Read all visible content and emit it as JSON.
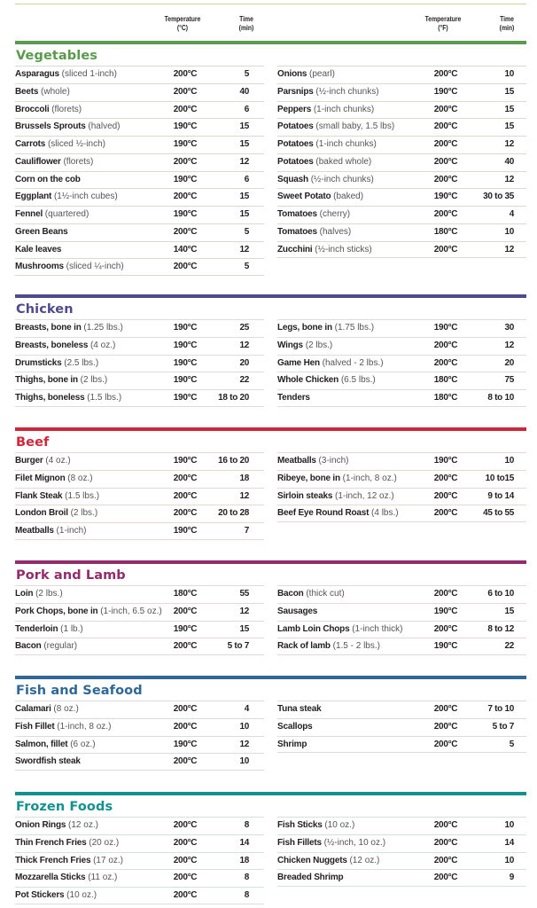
{
  "header": {
    "left_temp_label": "Temperature",
    "left_temp_unit": "(°C)",
    "left_time_label": "Time",
    "left_time_unit": "(min)",
    "right_temp_label": "Temperature",
    "right_temp_unit": "(°F)",
    "right_time_label": "Time",
    "right_time_unit": "(min)"
  },
  "colors": {
    "top_line": "#c9d59a",
    "vegetables": "#5a9a4c",
    "chicken": "#4f4a8c",
    "beef": "#d0263a",
    "pork": "#922c6c",
    "fish": "#2f6896",
    "frozen": "#14918e"
  },
  "sections": [
    {
      "title": "Vegetables",
      "left": [
        {
          "name": "Asparagus",
          "note": "(sliced 1-inch)",
          "temp": "200°C",
          "time": "5"
        },
        {
          "name": "Beets",
          "note": "(whole)",
          "temp": "200°C",
          "time": "40"
        },
        {
          "name": "Broccoli",
          "note": "(florets)",
          "temp": "200°C",
          "time": "6"
        },
        {
          "name": "Brussels Sprouts",
          "note": "(halved)",
          "temp": "190°C",
          "time": "15"
        },
        {
          "name": "Carrots",
          "note": "(sliced ½-inch)",
          "temp": "190°C",
          "time": "15"
        },
        {
          "name": "Cauliflower",
          "note": "(florets)",
          "temp": "200°C",
          "time": "12"
        },
        {
          "name": "Corn on the cob",
          "note": "",
          "temp": "190°C",
          "time": "6"
        },
        {
          "name": "Eggplant",
          "note": "(1½-inch cubes)",
          "temp": "200°C",
          "time": "15"
        },
        {
          "name": "Fennel",
          "note": "(quartered)",
          "temp": "190°C",
          "time": "15"
        },
        {
          "name": "Green Beans",
          "note": "",
          "temp": "200°C",
          "time": "5"
        },
        {
          "name": "Kale leaves",
          "note": "",
          "temp": "140°C",
          "time": "12"
        },
        {
          "name": "Mushrooms",
          "note": "(sliced ¼-inch)",
          "temp": "200°C",
          "time": "5"
        }
      ],
      "right": [
        {
          "name": "Onions",
          "note": "(pearl)",
          "temp": "200°C",
          "time": "10"
        },
        {
          "name": "Parsnips",
          "note": "(½-inch chunks)",
          "temp": "190°C",
          "time": "15"
        },
        {
          "name": "Peppers",
          "note": "(1-inch chunks)",
          "temp": "200°C",
          "time": "15"
        },
        {
          "name": "Potatoes",
          "note": "(small baby, 1.5 lbs)",
          "temp": "200°C",
          "time": "15"
        },
        {
          "name": "Potatoes",
          "note": "(1-inch chunks)",
          "temp": "200°C",
          "time": "12"
        },
        {
          "name": "Potatoes",
          "note": "(baked whole)",
          "temp": "200°C",
          "time": "40"
        },
        {
          "name": "Squash",
          "note": "(½-inch chunks)",
          "temp": "200°C",
          "time": "12"
        },
        {
          "name": "Sweet Potato",
          "note": "(baked)",
          "temp": "190°C",
          "time": "30 to 35"
        },
        {
          "name": "Tomatoes",
          "note": "(cherry)",
          "temp": "200°C",
          "time": "4"
        },
        {
          "name": "Tomatoes",
          "note": "(halves)",
          "temp": "180°C",
          "time": "10"
        },
        {
          "name": "Zucchini",
          "note": "(½-inch sticks)",
          "temp": "200°C",
          "time": "12"
        }
      ]
    },
    {
      "title": "Chicken",
      "left": [
        {
          "name": "Breasts, bone in",
          "note": "(1.25 lbs.)",
          "temp": "190°C",
          "time": "25"
        },
        {
          "name": "Breasts, boneless",
          "note": " (4 oz.)",
          "temp": "190°C",
          "time": "12"
        },
        {
          "name": "Drumsticks",
          "note": " (2.5 lbs.)",
          "temp": "190°C",
          "time": "20"
        },
        {
          "name": "Thighs, bone in",
          "note": " (2 lbs.)",
          "temp": "190°C",
          "time": "22"
        },
        {
          "name": "Thighs, boneless",
          "note": "(1.5 lbs.)",
          "temp": "190°C",
          "time": "18 to 20"
        }
      ],
      "right": [
        {
          "name": "Legs, bone in",
          "note": " (1.75 lbs.)",
          "temp": "190°C",
          "time": "30"
        },
        {
          "name": "Wings",
          "note": " (2 lbs.)",
          "temp": "200°C",
          "time": "12"
        },
        {
          "name": "Game Hen",
          "note": "(halved - 2 lbs.)",
          "temp": "200°C",
          "time": "20"
        },
        {
          "name": "Whole Chicken",
          "note": "(6.5 lbs.)",
          "temp": "180°C",
          "time": "75"
        },
        {
          "name": "Tenders",
          "note": "",
          "temp": "180°C",
          "time": "8 to 10"
        }
      ]
    },
    {
      "title": "Beef",
      "left": [
        {
          "name": "Burger",
          "note": " (4 oz.)",
          "temp": "190°C",
          "time": "16 to 20"
        },
        {
          "name": "Filet Mignon",
          "note": "(8 oz.)",
          "temp": "200°C",
          "time": "18"
        },
        {
          "name": "Flank Steak",
          "note": " (1.5 lbs.)",
          "temp": "200°C",
          "time": "12"
        },
        {
          "name": "London Broil",
          "note": " (2 lbs.)",
          "temp": "200°C",
          "time": "20 to 28"
        },
        {
          "name": "Meatballs",
          "note": "(1-inch)",
          "temp": "190°C",
          "time": "7"
        }
      ],
      "right": [
        {
          "name": "Meatballs",
          "note": "(3-inch)",
          "temp": "190°C",
          "time": "10"
        },
        {
          "name": "Ribeye, bone in",
          "note": "(1-inch, 8 oz.)",
          "temp": "200°C",
          "time": "10 to15"
        },
        {
          "name": "Sirloin steaks",
          "note": "(1-inch, 12 oz.)",
          "temp": "200°C",
          "time": "9 to 14"
        },
        {
          "name": "Beef Eye Round Roast",
          "note": "(4 lbs.)",
          "temp": "200°C",
          "time": "45 to 55"
        }
      ]
    },
    {
      "title": "Pork and Lamb",
      "left": [
        {
          "name": "Loin",
          "note": "(2 lbs.)",
          "temp": "180°C",
          "time": "55"
        },
        {
          "name": "Pork Chops, bone in",
          "note": "(1-inch, 6.5 oz.)",
          "temp": "200°C",
          "time": "12"
        },
        {
          "name": "Tenderloin",
          "note": "(1 lb.)",
          "temp": "190°C",
          "time": "15"
        },
        {
          "name": "Bacon",
          "note": "(regular)",
          "temp": "200°C",
          "time": "5 to 7"
        }
      ],
      "right": [
        {
          "name": "Bacon",
          "note": "(thick cut)",
          "temp": "200°C",
          "time": "6 to 10"
        },
        {
          "name": "Sausages",
          "note": "",
          "temp": "190°C",
          "time": "15"
        },
        {
          "name": "Lamb Loin Chops",
          "note": "(1-inch thick)",
          "temp": "200°C",
          "time": "8 to 12"
        },
        {
          "name": "Rack of lamb",
          "note": "(1.5 - 2 lbs.)",
          "temp": "190°C",
          "time": "22"
        }
      ]
    },
    {
      "title": "Fish and Seafood",
      "left": [
        {
          "name": "Calamari",
          "note": "(8 oz.)",
          "temp": "200°C",
          "time": "4"
        },
        {
          "name": "Fish Fillet",
          "note": "(1-inch, 8 oz.)",
          "temp": "200°C",
          "time": "10"
        },
        {
          "name": "Salmon, fillet",
          "note": " (6 oz.)",
          "temp": "190°C",
          "time": "12"
        },
        {
          "name": "Swordfish steak",
          "note": "",
          "temp": "200°C",
          "time": "10"
        }
      ],
      "right": [
        {
          "name": "Tuna steak",
          "note": "",
          "temp": "200°C",
          "time": "7 to 10"
        },
        {
          "name": "Scallops",
          "note": "",
          "temp": "200°C",
          "time": "5 to 7"
        },
        {
          "name": "Shrimp",
          "note": "",
          "temp": "200°C",
          "time": "5"
        }
      ]
    },
    {
      "title": "Frozen Foods",
      "left": [
        {
          "name": "Onion Rings",
          "note": " (12 oz.)",
          "temp": "200°C",
          "time": "8"
        },
        {
          "name": "Thin French Fries",
          "note": " (20 oz.)",
          "temp": "200°C",
          "time": "14"
        },
        {
          "name": "Thick French Fries",
          "note": "(17 oz.)",
          "temp": "200°C",
          "time": "18"
        },
        {
          "name": "Mozzarella Sticks",
          "note": "(11 oz.)",
          "temp": "200°C",
          "time": "8"
        },
        {
          "name": "Pot Stickers",
          "note": "(10 oz.)",
          "temp": "200°C",
          "time": "8"
        }
      ],
      "right": [
        {
          "name": "Fish Sticks",
          "note": "(10 oz.)",
          "temp": "200°C",
          "time": "10"
        },
        {
          "name": "Fish Fillets",
          "note": "(½-inch, 10 oz.)",
          "temp": "200°C",
          "time": "14"
        },
        {
          "name": "Chicken Nuggets",
          "note": " (12 oz.)",
          "temp": "200°C",
          "time": "10"
        },
        {
          "name": "Breaded Shrimp",
          "note": "",
          "temp": "200°C",
          "time": "9"
        }
      ]
    }
  ]
}
